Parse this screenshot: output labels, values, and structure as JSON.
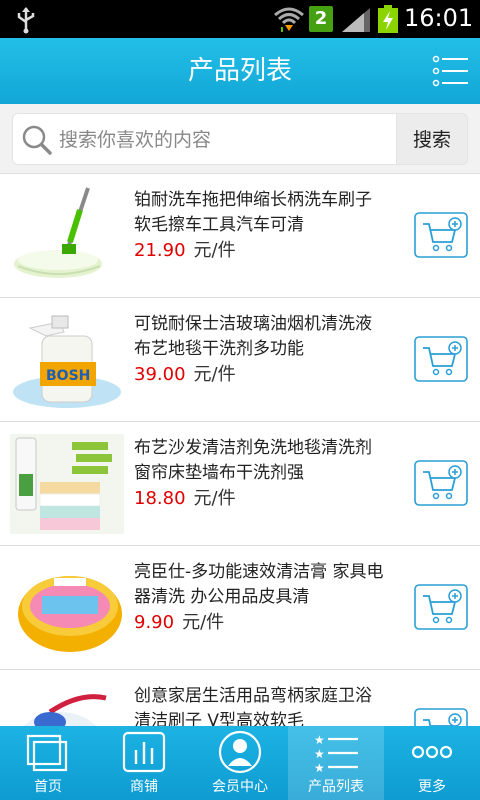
{
  "status_bar": {
    "sim_badge": "2",
    "time": "16:01"
  },
  "header": {
    "title": "产品列表"
  },
  "search": {
    "placeholder": "搜索你喜欢的内容",
    "button_label": "搜索"
  },
  "products": [
    {
      "name": "铂耐洗车拖把伸缩长柄洗车刷子软毛擦车工具汽车可清",
      "price": "21.90",
      "unit": "元/件"
    },
    {
      "name": "可锐耐保士洁玻璃油烟机清洗液 布艺地毯干洗剂多功能",
      "price": "39.00",
      "unit": "元/件"
    },
    {
      "name": "布艺沙发清洁剂免洗地毯清洗剂窗帘床垫墙布干洗剂强",
      "price": "18.80",
      "unit": "元/件"
    },
    {
      "name": "亮臣仕-多功能速效清洁膏 家具电器清洗 办公用品皮具清",
      "price": "9.90",
      "unit": "元/件"
    },
    {
      "name": "创意家居生活用品弯柄家庭卫浴清洁刷子 V型高效软毛",
      "price": "",
      "unit": ""
    }
  ],
  "nav": {
    "items": [
      {
        "label": "首页",
        "icon": "home-pages-icon"
      },
      {
        "label": "商铺",
        "icon": "chart-bars-icon"
      },
      {
        "label": "会员中心",
        "icon": "user-icon"
      },
      {
        "label": "产品列表",
        "icon": "star-list-icon"
      },
      {
        "label": "更多",
        "icon": "more-dots-icon"
      }
    ],
    "active_index": 3
  },
  "colors": {
    "accent": "#16aee0",
    "price": "#e00000",
    "cart_icon": "#2a9fd6"
  }
}
